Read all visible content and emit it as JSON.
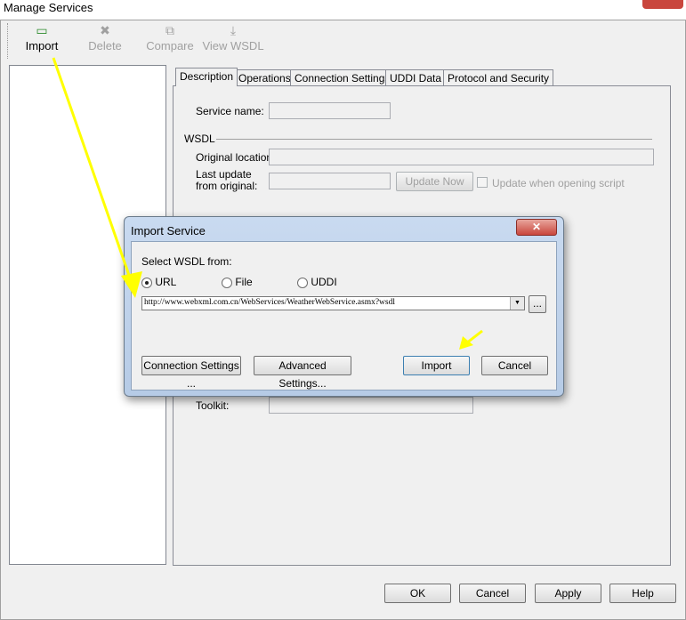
{
  "window": {
    "title": "Manage Services"
  },
  "toolbar": [
    {
      "label": "Import",
      "icon": "import-icon",
      "enabled": true
    },
    {
      "label": "Delete",
      "icon": "delete-icon",
      "enabled": false
    },
    {
      "label": "Compare",
      "icon": "compare-icon",
      "enabled": false
    },
    {
      "label": "View WSDL",
      "icon": "view-wsdl-icon",
      "enabled": false
    }
  ],
  "tabs": [
    "Description",
    "Operations",
    "Connection Settings",
    "UDDI Data",
    "Protocol and Security"
  ],
  "description": {
    "service_name_label": "Service name:",
    "wsdl_label": "WSDL",
    "original_location_label": "Original location:",
    "last_update_label_1": "Last update",
    "last_update_label_2": "from original:",
    "update_now": "Update Now",
    "update_on_open": "Update when opening script",
    "toolkit_label": "Toolkit:"
  },
  "footer": {
    "ok": "OK",
    "cancel": "Cancel",
    "apply": "Apply",
    "help": "Help"
  },
  "dialog": {
    "title": "Import Service",
    "select_label": "Select WSDL from:",
    "options": [
      "URL",
      "File",
      "UDDI"
    ],
    "selected": "URL",
    "url_value": "http://www.webxml.com.cn/WebServices/WeatherWebService.asmx?wsdl",
    "browse": "...",
    "connection_settings": "Connection Settings ...",
    "advanced_settings": "Advanced Settings...",
    "import": "Import",
    "cancel": "Cancel",
    "close": "✕"
  },
  "colors": {
    "annotation_arrow": "#ffff00",
    "close_button": "#c9463d"
  }
}
